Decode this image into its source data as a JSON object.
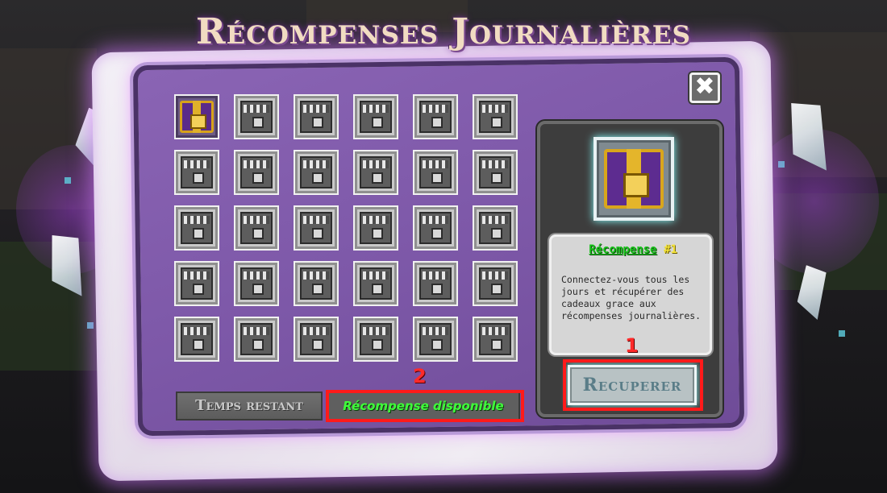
{
  "title": "Récompenses Journalières",
  "close_symbol": "✖",
  "reward_grid": {
    "rows": 5,
    "columns": 6,
    "active_index": 0
  },
  "info_panel": {
    "reward_label": "Récompense",
    "reward_number": "#1",
    "description": "Connectez-vous tous les jours et récupérer des cadeaux grace aux récompenses journalières.",
    "claim_button": "Recuperer"
  },
  "footer": {
    "time_label": "Temps restant",
    "status_value": "Récompense disponible"
  },
  "annotations": {
    "claim_marker": "1",
    "status_marker": "2",
    "color": "#ff1a1a"
  },
  "colors": {
    "panel": "#7d58a8",
    "gold_chest": "#d7a21a",
    "status_green": "#3fff3a"
  }
}
